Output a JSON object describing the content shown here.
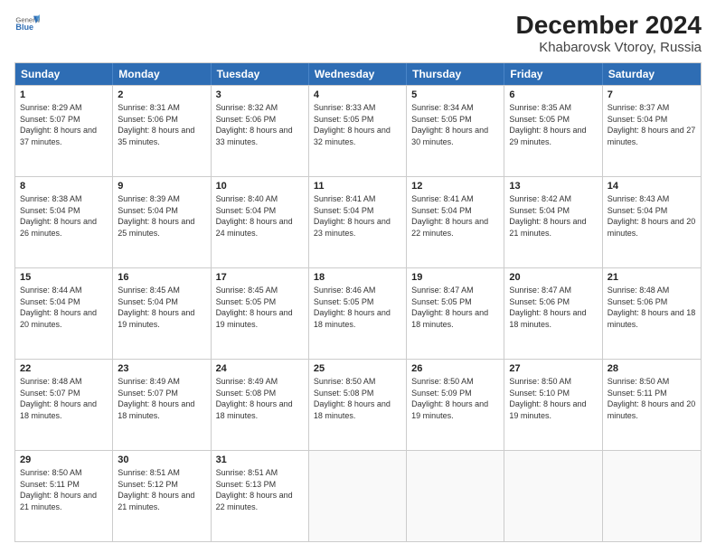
{
  "header": {
    "logo_general": "General",
    "logo_blue": "Blue",
    "month": "December 2024",
    "location": "Khabarovsk Vtoroy, Russia"
  },
  "weekdays": [
    "Sunday",
    "Monday",
    "Tuesday",
    "Wednesday",
    "Thursday",
    "Friday",
    "Saturday"
  ],
  "weeks": [
    [
      {
        "day": "1",
        "info": "Sunrise: 8:29 AM\nSunset: 5:07 PM\nDaylight: 8 hours and 37 minutes."
      },
      {
        "day": "2",
        "info": "Sunrise: 8:31 AM\nSunset: 5:06 PM\nDaylight: 8 hours and 35 minutes."
      },
      {
        "day": "3",
        "info": "Sunrise: 8:32 AM\nSunset: 5:06 PM\nDaylight: 8 hours and 33 minutes."
      },
      {
        "day": "4",
        "info": "Sunrise: 8:33 AM\nSunset: 5:05 PM\nDaylight: 8 hours and 32 minutes."
      },
      {
        "day": "5",
        "info": "Sunrise: 8:34 AM\nSunset: 5:05 PM\nDaylight: 8 hours and 30 minutes."
      },
      {
        "day": "6",
        "info": "Sunrise: 8:35 AM\nSunset: 5:05 PM\nDaylight: 8 hours and 29 minutes."
      },
      {
        "day": "7",
        "info": "Sunrise: 8:37 AM\nSunset: 5:04 PM\nDaylight: 8 hours and 27 minutes."
      }
    ],
    [
      {
        "day": "8",
        "info": "Sunrise: 8:38 AM\nSunset: 5:04 PM\nDaylight: 8 hours and 26 minutes."
      },
      {
        "day": "9",
        "info": "Sunrise: 8:39 AM\nSunset: 5:04 PM\nDaylight: 8 hours and 25 minutes."
      },
      {
        "day": "10",
        "info": "Sunrise: 8:40 AM\nSunset: 5:04 PM\nDaylight: 8 hours and 24 minutes."
      },
      {
        "day": "11",
        "info": "Sunrise: 8:41 AM\nSunset: 5:04 PM\nDaylight: 8 hours and 23 minutes."
      },
      {
        "day": "12",
        "info": "Sunrise: 8:41 AM\nSunset: 5:04 PM\nDaylight: 8 hours and 22 minutes."
      },
      {
        "day": "13",
        "info": "Sunrise: 8:42 AM\nSunset: 5:04 PM\nDaylight: 8 hours and 21 minutes."
      },
      {
        "day": "14",
        "info": "Sunrise: 8:43 AM\nSunset: 5:04 PM\nDaylight: 8 hours and 20 minutes."
      }
    ],
    [
      {
        "day": "15",
        "info": "Sunrise: 8:44 AM\nSunset: 5:04 PM\nDaylight: 8 hours and 20 minutes."
      },
      {
        "day": "16",
        "info": "Sunrise: 8:45 AM\nSunset: 5:04 PM\nDaylight: 8 hours and 19 minutes."
      },
      {
        "day": "17",
        "info": "Sunrise: 8:45 AM\nSunset: 5:05 PM\nDaylight: 8 hours and 19 minutes."
      },
      {
        "day": "18",
        "info": "Sunrise: 8:46 AM\nSunset: 5:05 PM\nDaylight: 8 hours and 18 minutes."
      },
      {
        "day": "19",
        "info": "Sunrise: 8:47 AM\nSunset: 5:05 PM\nDaylight: 8 hours and 18 minutes."
      },
      {
        "day": "20",
        "info": "Sunrise: 8:47 AM\nSunset: 5:06 PM\nDaylight: 8 hours and 18 minutes."
      },
      {
        "day": "21",
        "info": "Sunrise: 8:48 AM\nSunset: 5:06 PM\nDaylight: 8 hours and 18 minutes."
      }
    ],
    [
      {
        "day": "22",
        "info": "Sunrise: 8:48 AM\nSunset: 5:07 PM\nDaylight: 8 hours and 18 minutes."
      },
      {
        "day": "23",
        "info": "Sunrise: 8:49 AM\nSunset: 5:07 PM\nDaylight: 8 hours and 18 minutes."
      },
      {
        "day": "24",
        "info": "Sunrise: 8:49 AM\nSunset: 5:08 PM\nDaylight: 8 hours and 18 minutes."
      },
      {
        "day": "25",
        "info": "Sunrise: 8:50 AM\nSunset: 5:08 PM\nDaylight: 8 hours and 18 minutes."
      },
      {
        "day": "26",
        "info": "Sunrise: 8:50 AM\nSunset: 5:09 PM\nDaylight: 8 hours and 19 minutes."
      },
      {
        "day": "27",
        "info": "Sunrise: 8:50 AM\nSunset: 5:10 PM\nDaylight: 8 hours and 19 minutes."
      },
      {
        "day": "28",
        "info": "Sunrise: 8:50 AM\nSunset: 5:11 PM\nDaylight: 8 hours and 20 minutes."
      }
    ],
    [
      {
        "day": "29",
        "info": "Sunrise: 8:50 AM\nSunset: 5:11 PM\nDaylight: 8 hours and 21 minutes."
      },
      {
        "day": "30",
        "info": "Sunrise: 8:51 AM\nSunset: 5:12 PM\nDaylight: 8 hours and 21 minutes."
      },
      {
        "day": "31",
        "info": "Sunrise: 8:51 AM\nSunset: 5:13 PM\nDaylight: 8 hours and 22 minutes."
      },
      {
        "day": "",
        "info": ""
      },
      {
        "day": "",
        "info": ""
      },
      {
        "day": "",
        "info": ""
      },
      {
        "day": "",
        "info": ""
      }
    ]
  ]
}
